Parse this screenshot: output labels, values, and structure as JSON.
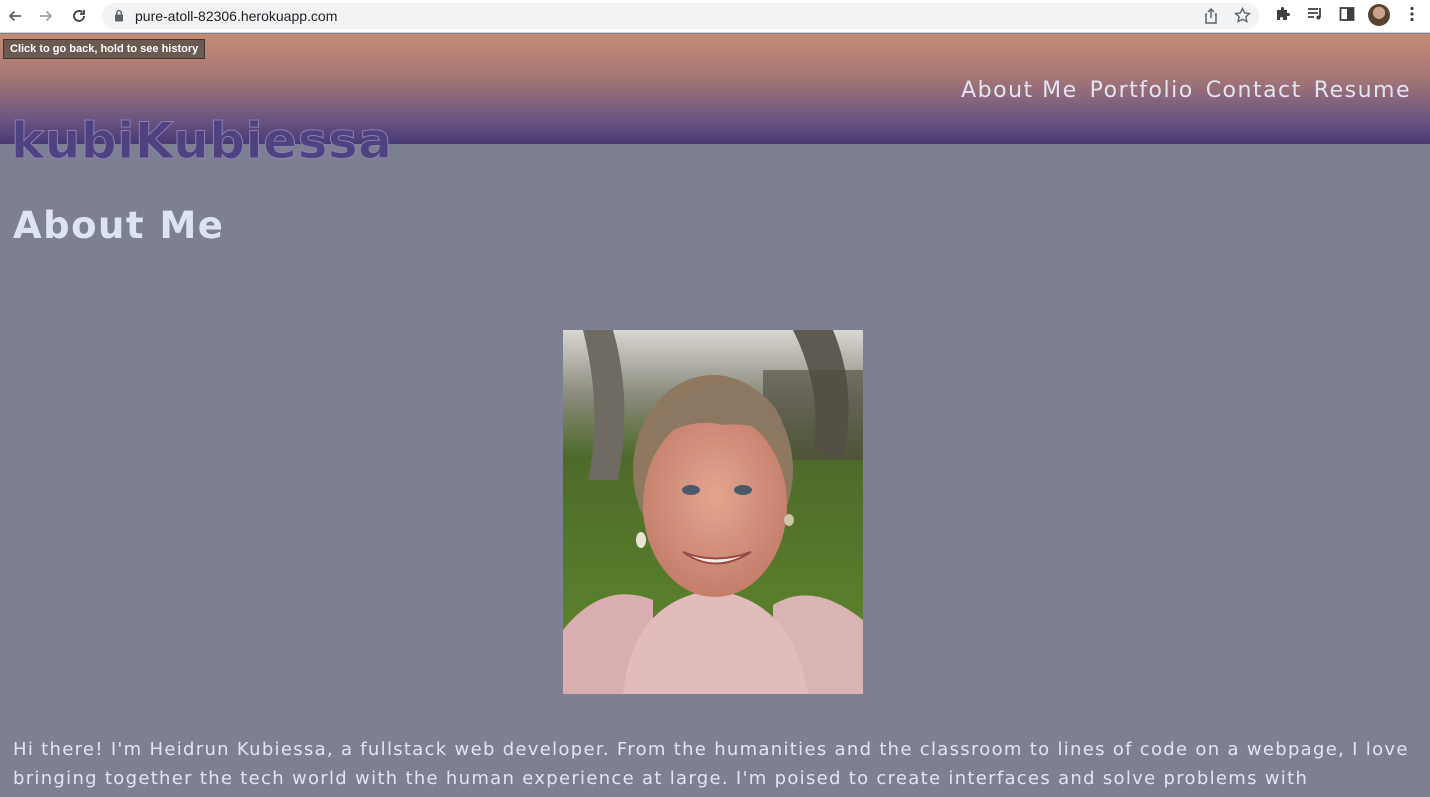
{
  "browser": {
    "url": "pure-atoll-82306.herokuapp.com",
    "tooltip": "Click to go back, hold to see history",
    "icons": [
      "back-icon",
      "forward-icon",
      "reload-icon",
      "lock-icon",
      "share-icon",
      "star-icon",
      "extensions-icon",
      "media-icon",
      "side-panel-icon",
      "profile-avatar",
      "menu-icon"
    ]
  },
  "site": {
    "brand": "kubiKubiessa",
    "nav": [
      "About Me",
      "Portfolio",
      "Contact",
      "Resume"
    ],
    "section_title": "About Me",
    "bio": "Hi there! I'm Heidrun Kubiessa, a fullstack web developer. From the humanities and the classroom to lines of code on a webpage, I love bringing together the tech world with the human experience at large. I'm poised to create interfaces and solve problems with"
  },
  "colors": {
    "page_bg": "#7d8093",
    "header_top": "#c68a73",
    "header_bottom": "#4a3a76",
    "brand_text": "#4f4280",
    "light_text": "#e2e4f3"
  }
}
